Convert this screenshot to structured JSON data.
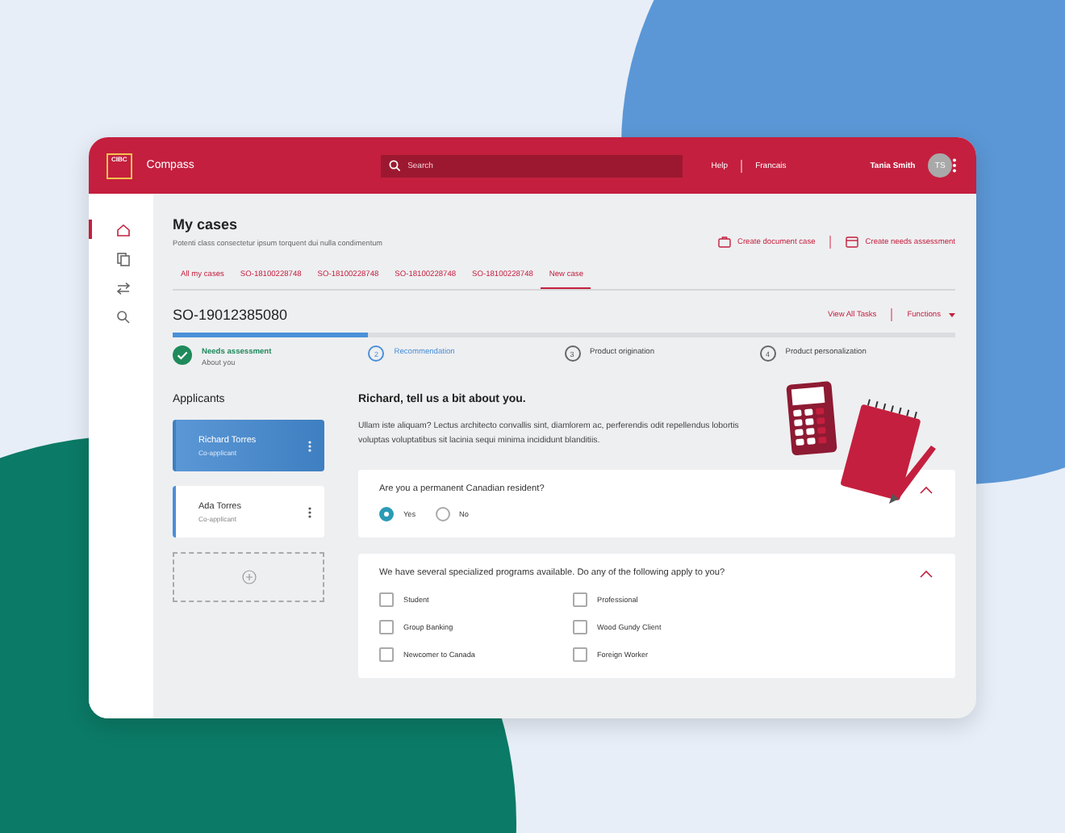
{
  "header": {
    "brand": "Compass",
    "logo": "CIBC",
    "search": {
      "placeholder": "Search"
    },
    "links": [
      "Help",
      "Francais"
    ],
    "user": "Tania Smith",
    "avatar": "TS"
  },
  "sidebar": {
    "items": [
      {
        "selected": true
      },
      {
        "selected": false
      },
      {
        "selected": false
      },
      {
        "selected": false
      }
    ]
  },
  "page": {
    "title": "My cases",
    "subtitle": "Potenti class consectetur ipsum torquent dui nulla condimentum",
    "actions": [
      "Create document case",
      "Create needs assessment"
    ]
  },
  "tabs": [
    {
      "label": "All my cases",
      "selected": false
    },
    {
      "label": "SO-18100228748",
      "selected": false
    },
    {
      "label": "SO-18100228748",
      "selected": false
    },
    {
      "label": "SO-18100228748",
      "selected": false
    },
    {
      "label": "SO-18100228748",
      "selected": false
    },
    {
      "label": "New case",
      "selected": true
    }
  ],
  "case": {
    "number": "SO-19012385080",
    "links": [
      "View All Tasks",
      "Functions"
    ],
    "progress": {
      "level": 0.25
    }
  },
  "steps": [
    {
      "label": "Needs assessment",
      "sublabel": "About you",
      "kind": "done"
    },
    {
      "number": "2",
      "label": "Recommendation",
      "kind": "current"
    },
    {
      "number": "3",
      "label": "Product origination",
      "kind": "upcoming"
    },
    {
      "number": "4",
      "label": "Product personalization",
      "kind": "upcoming"
    }
  ],
  "applicants": {
    "title": "Applicants",
    "items": [
      {
        "name": "Richard Torres",
        "role": "Co-applicant",
        "selected": true
      },
      {
        "name": "Ada Torres",
        "role": "Co-applicant",
        "selected": false
      }
    ]
  },
  "intro": {
    "heading": "Richard, tell us a bit about you.",
    "text": "Ullam iste aliquam? Lectus architecto convallis sint, diamlorem ac, perferendis odit repellendus lobortis voluptas voluptatibus sit lacinia sequi minima incididunt blanditiis."
  },
  "questions": [
    {
      "kind": "radio",
      "text": "Are you a permanent Canadian resident?",
      "expanded": true,
      "options": [
        {
          "label": "Yes",
          "selected": true
        },
        {
          "label": "No",
          "selected": false
        }
      ]
    },
    {
      "kind": "checkbox",
      "text": "We have several specialized programs available. Do any of the following apply to you?",
      "expanded": true,
      "options": [
        {
          "label": "Student",
          "checked": false
        },
        {
          "label": "Professional",
          "checked": false
        },
        {
          "label": "Group Banking",
          "checked": false
        },
        {
          "label": "Wood Gundy Client",
          "checked": false
        },
        {
          "label": "Newcomer to Canada",
          "checked": false
        },
        {
          "label": "Foreign Worker",
          "checked": false
        }
      ]
    }
  ]
}
